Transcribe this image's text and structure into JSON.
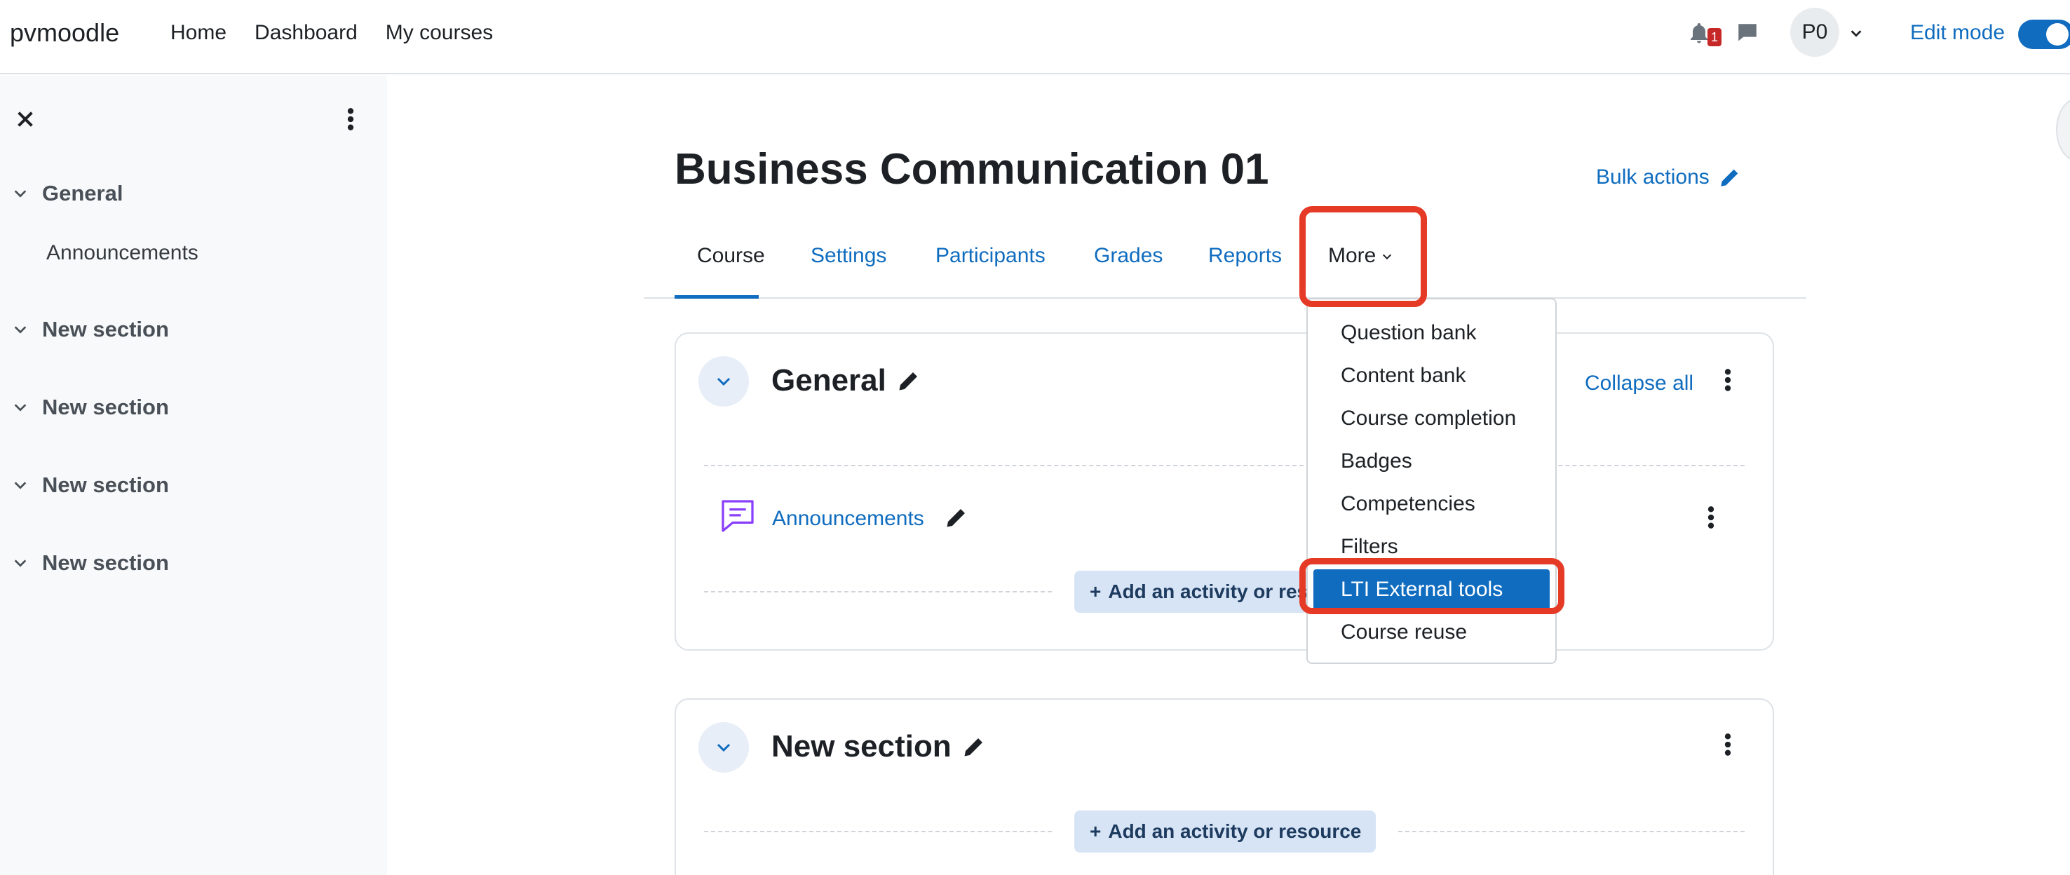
{
  "navbar": {
    "brand": "pvmoodle",
    "links": [
      "Home",
      "Dashboard",
      "My courses"
    ],
    "notification_count": "1",
    "user_initials": "P0",
    "edit_mode_label": "Edit mode",
    "edit_mode_on": true,
    "icons": {
      "notifications": "bell-icon",
      "messages": "chat-icon",
      "user_menu": "chevron-down-icon"
    }
  },
  "drawer": {
    "sections": [
      {
        "title": "General",
        "activities": [
          "Announcements"
        ]
      },
      {
        "title": "New section",
        "activities": []
      },
      {
        "title": "New section",
        "activities": []
      },
      {
        "title": "New section",
        "activities": []
      },
      {
        "title": "New section",
        "activities": []
      }
    ]
  },
  "course": {
    "title": "Business Communication 01",
    "bulk_actions": "Bulk actions",
    "tabs": [
      {
        "label": "Course",
        "active": true
      },
      {
        "label": "Settings"
      },
      {
        "label": "Participants"
      },
      {
        "label": "Grades"
      },
      {
        "label": "Reports"
      },
      {
        "label": "More"
      }
    ]
  },
  "more_menu": {
    "items": [
      "Question bank",
      "Content bank",
      "Course completion",
      "Badges",
      "Competencies",
      "Filters",
      "LTI External tools",
      "Course reuse"
    ],
    "active_item": "LTI External tools"
  },
  "sections": [
    {
      "title": "General",
      "collapse_all": "Collapse all",
      "activities": [
        {
          "name": "Announcements",
          "icon": "forum-icon"
        }
      ],
      "add_label": "Add an activity or resource"
    },
    {
      "title": "New section",
      "add_label": "Add an activity or resource"
    }
  ],
  "colors": {
    "accent": "#0f6cbf",
    "highlight": "#e53a26",
    "drawer_bg": "#f8f9fa"
  }
}
